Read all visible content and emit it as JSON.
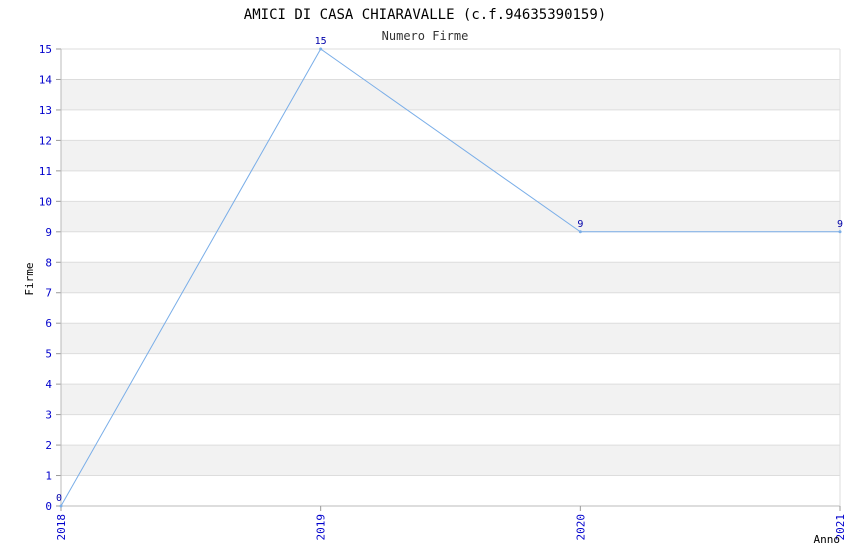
{
  "chart_data": {
    "type": "line",
    "title": "AMICI DI CASA CHIARAVALLE (c.f.94635390159)",
    "subtitle": "Numero Firme",
    "xlabel": "Anno",
    "ylabel": "Firme",
    "categories": [
      "2018",
      "2019",
      "2020",
      "2021"
    ],
    "series": [
      {
        "values": [
          0,
          15,
          9,
          9
        ]
      }
    ],
    "ylim": [
      0,
      15
    ],
    "yticks": [
      "0",
      "1",
      "2",
      "3",
      "4",
      "5",
      "6",
      "7",
      "8",
      "9",
      "10",
      "11",
      "12",
      "13",
      "14",
      "15"
    ],
    "grid": true,
    "colors": {
      "line": "#7aaee8",
      "band": "#f2f2f2",
      "grid": "#dddddd",
      "tick_text": "#0000cc",
      "data_label": "#0000aa"
    }
  }
}
